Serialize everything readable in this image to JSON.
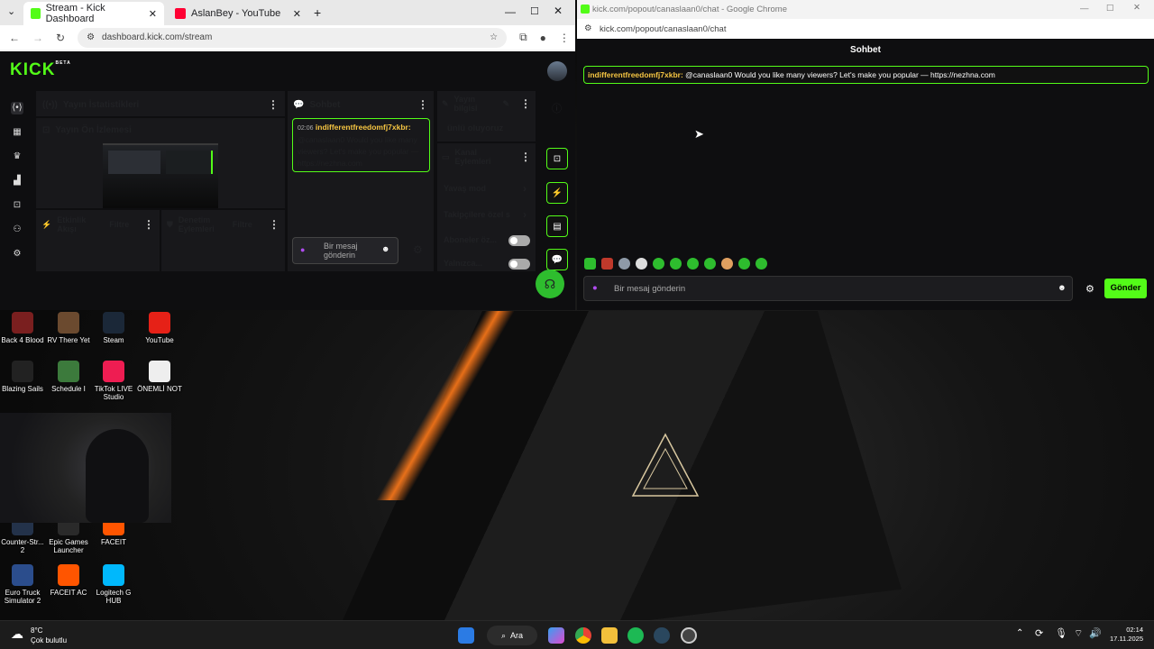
{
  "left_window": {
    "tabs": [
      {
        "label": "Stream - Kick Dashboard",
        "icon": "kick-icon"
      },
      {
        "label": "AslanBey - YouTube",
        "icon": "youtube-icon"
      }
    ],
    "url": "dashboard.kick.com/stream"
  },
  "dashboard": {
    "logo": "KICK",
    "logo_tag": "BETA",
    "stats_title": "Yayın İstatistikleri",
    "preview_title": "Yayın Ön İzlemesi",
    "activity_title": "Etkinlik Akışı",
    "activity_filter": "Filtre",
    "moderation_title": "Denetim Eylemleri",
    "moderation_filter": "Filtre",
    "chat_title": "Sohbet",
    "chat_message": {
      "time": "02:06",
      "user": "indifferentfreedomfj7xkbr:",
      "text": "@canaslaan0 Would you like many viewers? Let's make you popular — https://nezhna.com"
    },
    "chat_input_placeholder": "Bir mesaj gönderin",
    "stream_info_title": "Yayın bilgisi",
    "stream_info_value": "ünlü oluyoruz",
    "channel_actions_title": "Kanal Eylemleri",
    "channel_actions": [
      {
        "label": "Yavaş mod",
        "control": "chevron"
      },
      {
        "label": "Takipçilere özel s",
        "control": "chevron"
      },
      {
        "label": "Aboneler öz...",
        "control": "toggle"
      },
      {
        "label": "Yalnızca...",
        "control": "toggle"
      }
    ]
  },
  "right_window": {
    "title": "kick.com/popout/canaslaan0/chat - Google Chrome",
    "url": "kick.com/popout/canaslaan0/chat",
    "chat_header": "Sohbet",
    "message_user": "indifferentfreedomfj7xkbr:",
    "message_text": "@canaslaan0 Would you like many viewers? Let's make you popular — https://nezhna.com",
    "input_placeholder": "Bir mesaj gönderin",
    "send_label": "Gönder"
  },
  "desktop_icons": [
    {
      "label": "Back 4 Blood",
      "color": "#7a1f1f"
    },
    {
      "label": "RV There Yet",
      "color": "#6b4a2f"
    },
    {
      "label": "Steam",
      "color": "#1b2838"
    },
    {
      "label": "YouTube",
      "color": "#e62117"
    },
    {
      "label": "Blazing Sails",
      "color": "#222222"
    },
    {
      "label": "Schedule I",
      "color": "#3c7a3c"
    },
    {
      "label": "TikTok LIVE Studio",
      "color": "#ee1d52"
    },
    {
      "label": "ÖNEMLİ NOT",
      "color": "#eeeeee"
    },
    {
      "label": "Counter-Str... 2",
      "color": "#23324a"
    },
    {
      "label": "Epic Games Launcher",
      "color": "#2a2a2a"
    },
    {
      "label": "FACEIT",
      "color": "#ff5500"
    },
    {
      "label": "Euro Truck Simulator 2",
      "color": "#2b4d8c"
    },
    {
      "label": "FACEIT AC",
      "color": "#ff5500"
    },
    {
      "label": "Logitech G HUB",
      "color": "#00b8fc"
    }
  ],
  "taskbar": {
    "weather_temp": "8°C",
    "weather_desc": "Çok bulutlu",
    "search_label": "Ara",
    "time": "02:14",
    "date": "17.11.2025"
  },
  "colors": {
    "kick_green": "#53fc18",
    "dash_bg": "#0e0e10",
    "panel_bg": "#18181b"
  }
}
